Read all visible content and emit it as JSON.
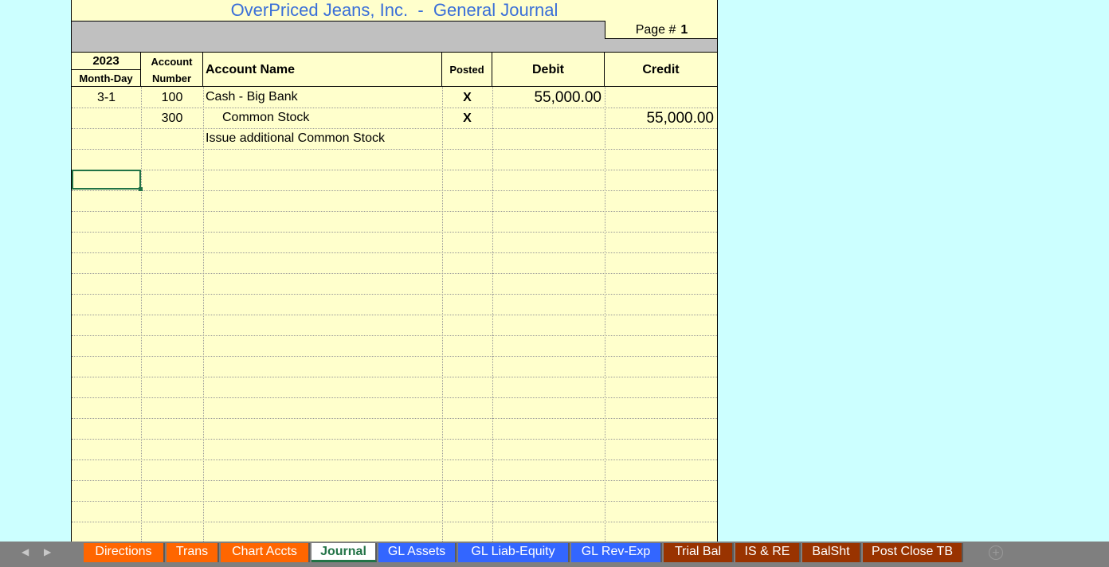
{
  "title": "OverPriced Jeans, Inc.  -  General Journal",
  "page": {
    "label": "Page #",
    "number": "1"
  },
  "headers": {
    "year": "2023",
    "month_day": "Month-Day",
    "account_top": "Account",
    "account_bottom": "Number",
    "account_name": "Account Name",
    "posted": "Posted",
    "debit": "Debit",
    "credit": "Credit"
  },
  "rows": [
    {
      "date": "3-1",
      "account": "100",
      "name": "Cash - Big Bank",
      "posted": "X",
      "debit": "55,000.00",
      "credit": ""
    },
    {
      "date": "",
      "account": "300",
      "name": "Common Stock",
      "posted": "X",
      "debit": "",
      "credit": "55,000.00"
    },
    {
      "date": "",
      "account": "",
      "name": "Issue additional Common Stock",
      "posted": "",
      "debit": "",
      "credit": ""
    }
  ],
  "tabs": [
    {
      "label": "Directions",
      "color": "#ff6600"
    },
    {
      "label": "Trans",
      "color": "#ff6600"
    },
    {
      "label": "Chart Accts",
      "color": "#ff6600"
    },
    {
      "label": "Journal",
      "color": "#ffffff"
    },
    {
      "label": "GL Assets",
      "color": "#3366ff"
    },
    {
      "label": "GL Liab-Equity",
      "color": "#3366ff"
    },
    {
      "label": "GL Rev-Exp",
      "color": "#3366ff"
    },
    {
      "label": "Trial Bal",
      "color": "#993300"
    },
    {
      "label": "IS & RE",
      "color": "#993300"
    },
    {
      "label": "BalSht",
      "color": "#993300"
    },
    {
      "label": "Post Close TB",
      "color": "#993300"
    }
  ],
  "active_tab": "Journal",
  "colors": {
    "sheet_bg": "#ffffcc",
    "outside_bg": "#ccffff",
    "title": "#3a6fd8",
    "selection": "#217346"
  }
}
